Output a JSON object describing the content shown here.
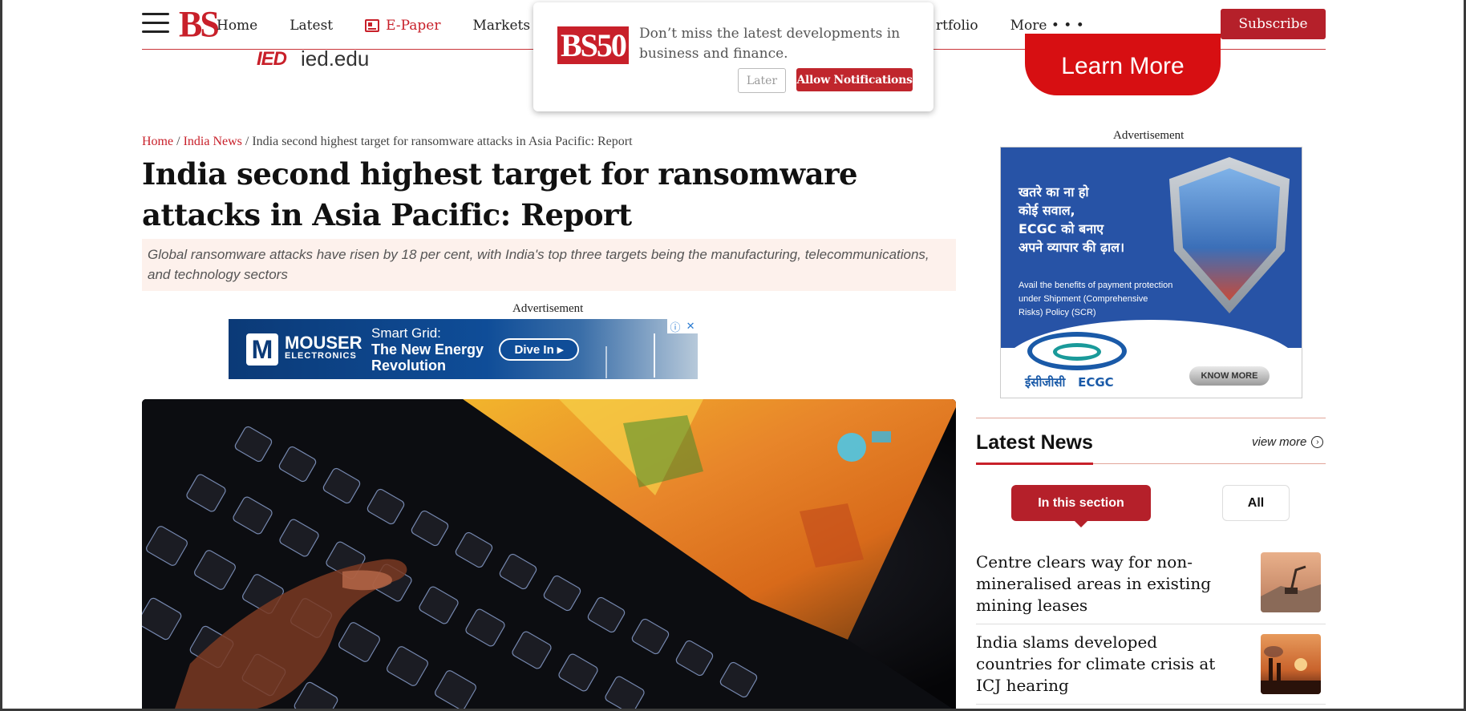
{
  "header": {
    "logo": "BS",
    "nav": [
      "Home",
      "Latest",
      "E-Paper",
      "Markets"
    ],
    "nav_right": [
      "rtfolio",
      "More • • •"
    ],
    "subscribe": "Subscribe"
  },
  "top_ad": {
    "brand": "IED",
    "url": "ied.edu",
    "cta": "Learn More"
  },
  "notification": {
    "logo": "BS50",
    "message": "Don’t miss the latest developments in business and finance.",
    "later": "Later",
    "allow": "Allow Notifications"
  },
  "breadcrumb": {
    "home": "Home",
    "section": "India News",
    "current": "India second highest target for ransomware attacks in Asia Pacific: Report",
    "separator": " / "
  },
  "article": {
    "headline": "India second highest target for ransomware attacks in Asia Pacific: Report",
    "summary": "Global ransomware attacks have risen by 18 per cent, with India's top three targets being the manufacturing, telecommunications, and technology sectors"
  },
  "ads": {
    "label": "Advertisement",
    "mouser": {
      "brand": "MOUSER",
      "brand_sub": "ELECTRONICS",
      "line1": "Smart Grid:",
      "line2": "The New Energy",
      "line3": "Revolution",
      "cta": "Dive In ▸"
    },
    "ecgc": {
      "hindi_1": "खतरे का ना हो",
      "hindi_2": "कोई सवाल,",
      "hindi_3": "ECGC को बनाए",
      "hindi_4": "अपने व्यापार की ढ़ाल।",
      "small": "Avail the benefits of payment protection under Shipment (Comprehensive Risks) Policy (SCR)",
      "name": "ईसीजीसी   ECGC",
      "cta": "KNOW MORE"
    }
  },
  "latest_news": {
    "title": "Latest News",
    "view_more": "view more",
    "tab_section": "In this section",
    "tab_all": "All",
    "items": [
      {
        "title": "Centre clears way for non-mineralised areas in existing mining leases"
      },
      {
        "title": "India slams developed countries for climate crisis at ICJ hearing"
      }
    ]
  },
  "colors": {
    "brand_red": "#c8202a",
    "subscribe_red": "#b5202a",
    "summary_bg": "#fdf1ec"
  }
}
